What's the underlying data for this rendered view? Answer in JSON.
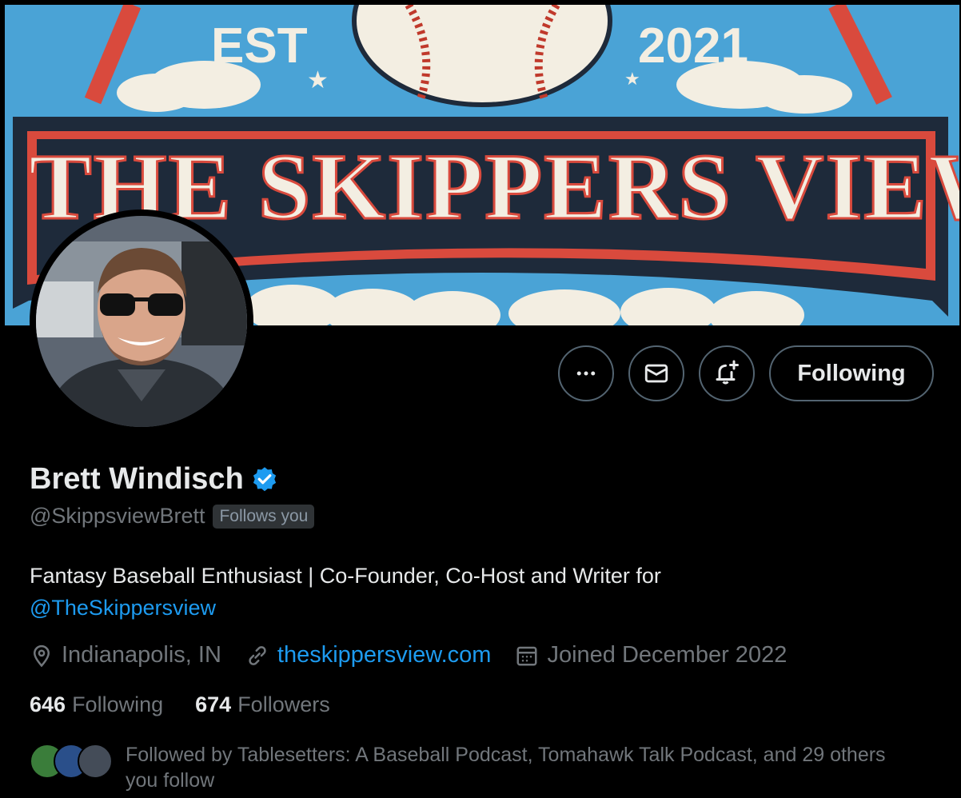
{
  "banner": {
    "est": "EST",
    "year": "2021",
    "title": "THE SKIPPERS VIEW"
  },
  "actions": {
    "more_icon": "more-horizontal-icon",
    "message_icon": "envelope-icon",
    "notify_icon": "bell-plus-icon",
    "following_label": "Following"
  },
  "profile": {
    "name": "Brett Windisch",
    "handle": "@SkippsviewBrett",
    "follows_you": "Follows you",
    "bio_text": "Fantasy Baseball Enthusiast | Co-Founder, Co-Host and Writer for",
    "bio_mention": "@TheSkippersview",
    "location": "Indianapolis, IN",
    "website": "theskippersview.com",
    "joined": "Joined December 2022"
  },
  "stats": {
    "following_count": "646",
    "following_label": "Following",
    "followers_count": "674",
    "followers_label": "Followers"
  },
  "followed_by": {
    "text": "Followed by Tablesetters: A Baseball Podcast, Tomahawk Talk Podcast, and 29 others you follow"
  },
  "colors": {
    "background": "#000000",
    "accent": "#1d9bf0",
    "muted": "#71767b",
    "banner_red": "#d94a3d",
    "banner_blue": "#4aa3d6"
  }
}
